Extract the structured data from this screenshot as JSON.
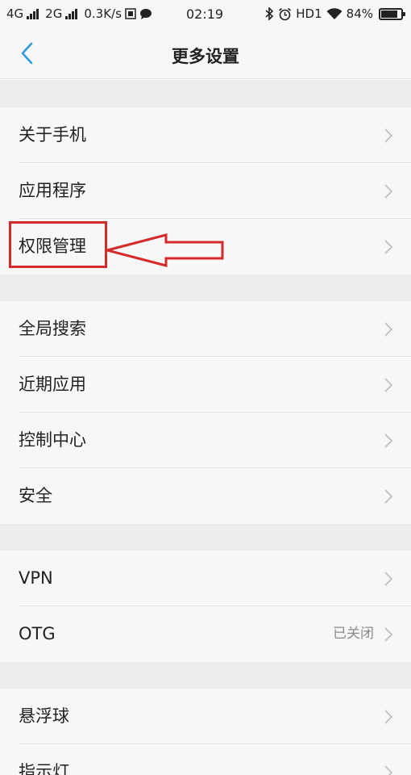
{
  "status_bar": {
    "net1": "4G",
    "net2": "2G",
    "speed": "0.3K/s",
    "time": "02:19",
    "hd": "HD1",
    "battery_percent": "84%",
    "battery_level": 0.84
  },
  "nav": {
    "title": "更多设置",
    "back_icon": "chevron-left-icon"
  },
  "group1": [
    {
      "label": "关于手机"
    },
    {
      "label": "应用程序"
    },
    {
      "label": "权限管理"
    }
  ],
  "group2": [
    {
      "label": "全局搜索"
    },
    {
      "label": "近期应用"
    },
    {
      "label": "控制中心"
    },
    {
      "label": "安全"
    }
  ],
  "group3": [
    {
      "label": "VPN"
    },
    {
      "label": "OTG",
      "value": "已关闭"
    }
  ],
  "group4": [
    {
      "label": "悬浮球"
    },
    {
      "label": "指示灯"
    }
  ],
  "colors": {
    "accent": "#2e9cdf",
    "annotation": "#d42a2a"
  }
}
